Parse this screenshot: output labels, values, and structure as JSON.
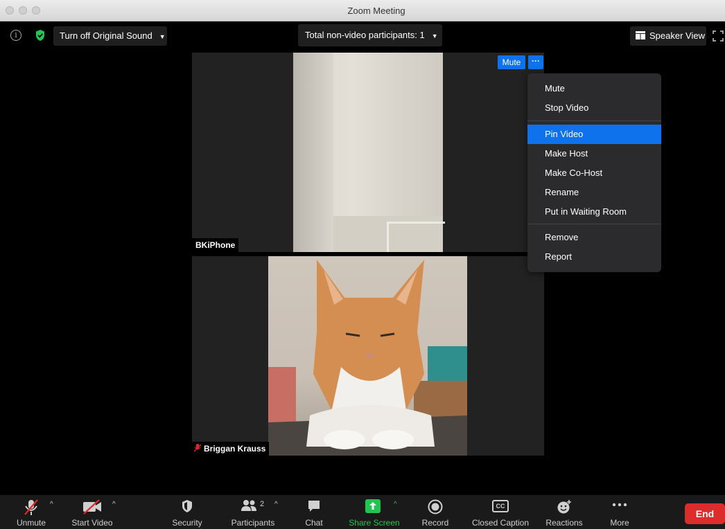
{
  "window": {
    "title": "Zoom Meeting"
  },
  "topbar": {
    "info_icon": "info-icon",
    "security_icon": "shield-check-icon",
    "original_sound_label": "Turn off Original Sound",
    "participants_label": "Total non-video participants: 1",
    "speaker_view_label": "Speaker View"
  },
  "videos": {
    "top": {
      "name": "BKiPhone"
    },
    "bottom": {
      "name": "Briggan Krauss"
    },
    "mute_label": "Mute",
    "more_label": "···"
  },
  "context_menu": {
    "items": [
      "Mute",
      "Stop Video",
      "Pin Video",
      "Make Host",
      "Make Co-Host",
      "Rename",
      "Put in Waiting Room",
      "Remove",
      "Report"
    ],
    "active": "Pin Video"
  },
  "toolbar": {
    "unmute": "Unmute",
    "start_video": "Start Video",
    "security": "Security",
    "participants": "Participants",
    "participants_count": "2",
    "chat": "Chat",
    "share_screen": "Share Screen",
    "record": "Record",
    "closed_caption": "Closed Caption",
    "cc_icon_text": "CC",
    "reactions": "Reactions",
    "more": "More",
    "end": "End"
  },
  "colors": {
    "accent_blue": "#0e72ed",
    "share_green": "#23c552",
    "end_red": "#dd2c2c",
    "muted_red": "#e02828"
  }
}
